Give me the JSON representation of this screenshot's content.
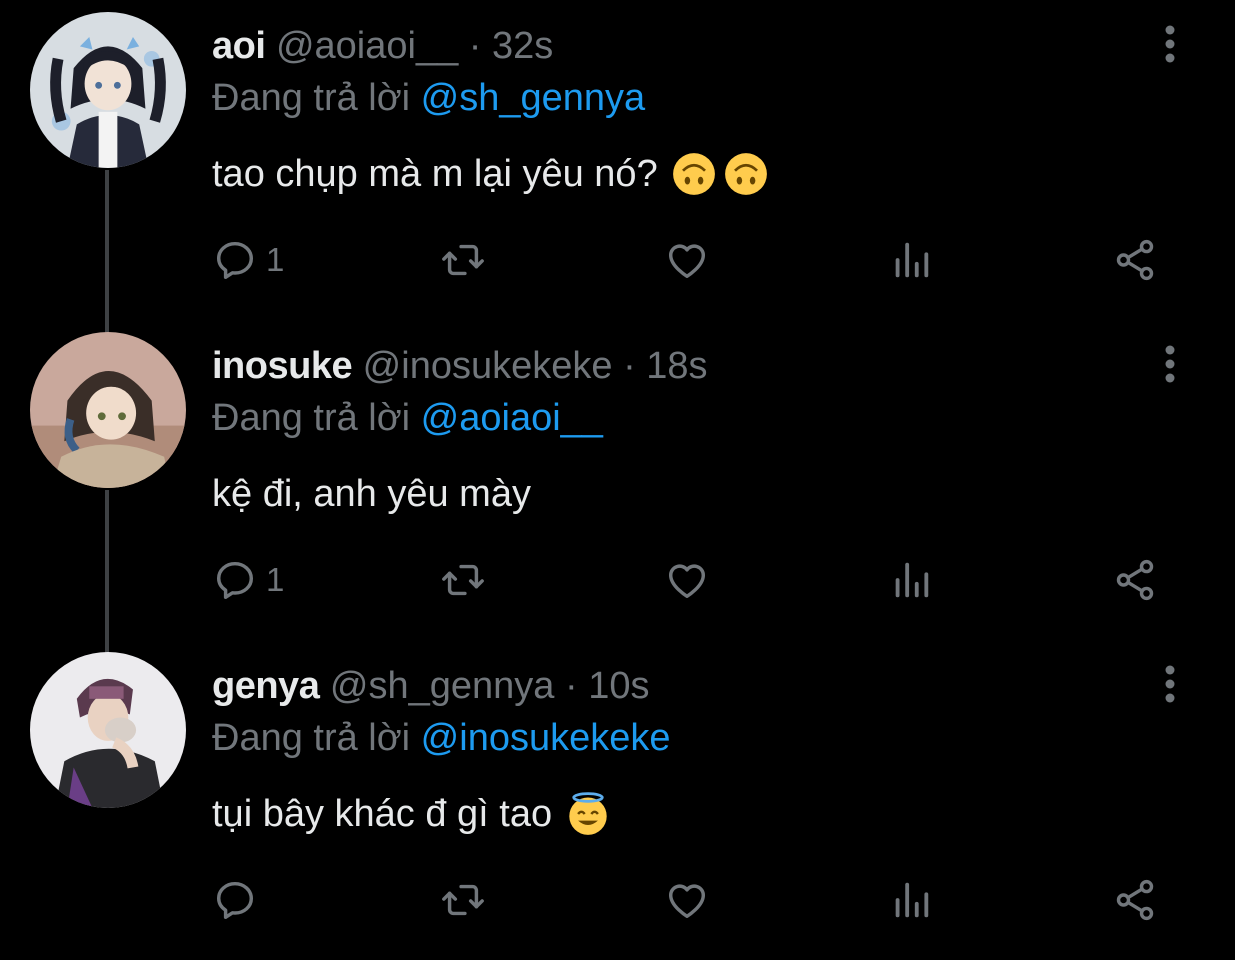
{
  "tweets": [
    {
      "display_name": "aoi",
      "handle": "@aoiaoi__",
      "separator": "·",
      "time": "32s",
      "reply_prefix": "Đang trả lời ",
      "reply_mention": "@sh_gennya",
      "text": "tao chụp mà m lại yêu nó?",
      "emojis": [
        "upside-down-face-icon",
        "upside-down-face-icon"
      ],
      "reply_count": "1"
    },
    {
      "display_name": "inosuke",
      "handle": "@inosukekeke",
      "separator": "·",
      "time": "18s",
      "reply_prefix": "Đang trả lời ",
      "reply_mention": "@aoiaoi__",
      "text": "kệ đi, anh yêu mày",
      "emojis": [],
      "reply_count": "1"
    },
    {
      "display_name": "genya",
      "handle": "@sh_gennya",
      "separator": "·",
      "time": "10s",
      "reply_prefix": "Đang trả lời ",
      "reply_mention": "@inosukekeke",
      "text": "tụi bây khác đ gì tao",
      "emojis": [
        "smiling-face-with-halo-icon"
      ],
      "reply_count": ""
    }
  ],
  "colors": {
    "background": "#000000",
    "text": "#e7e9ea",
    "secondary": "#71767b",
    "mention": "#1d9bf0",
    "thread_line": "#3e4144"
  }
}
